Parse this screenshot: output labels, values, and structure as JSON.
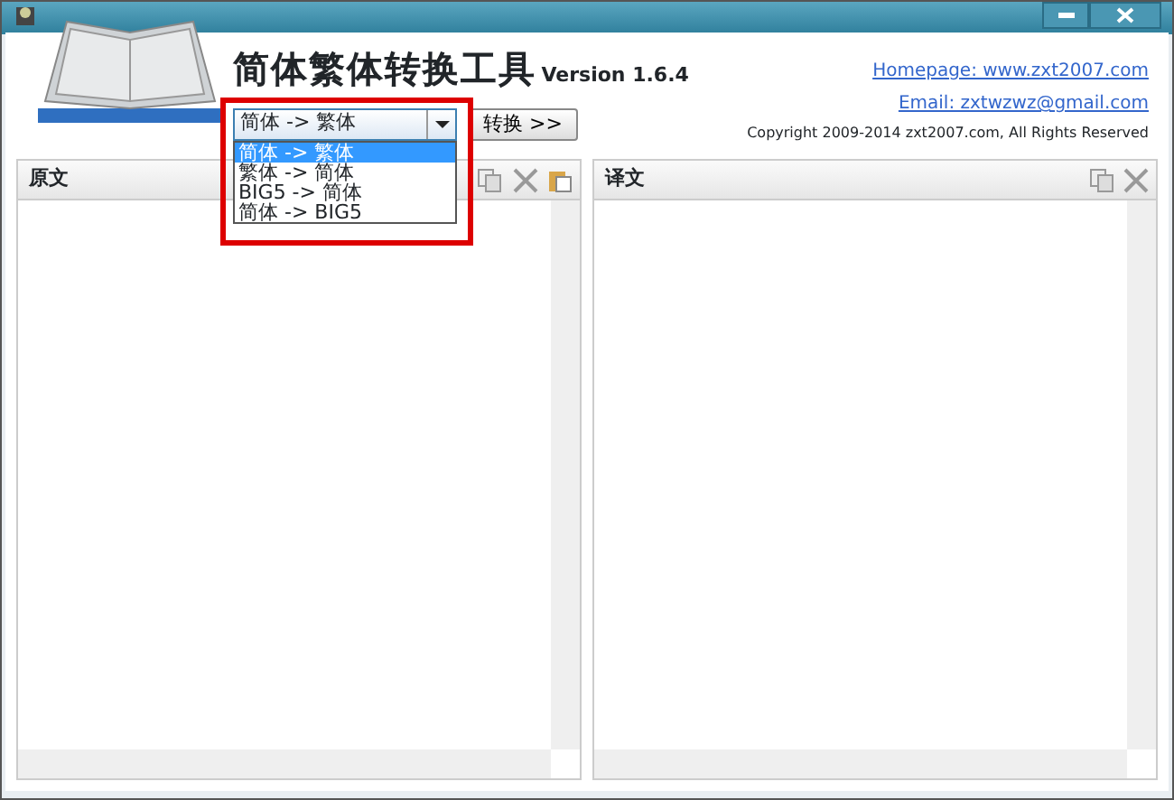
{
  "app_title": "简体繁体转换工具",
  "version": "Version 1.6.4",
  "links": [
    "Homepage: www.zxt2007.com",
    "Email: zxtwzwz@gmail.com"
  ],
  "copyright": "Copyright 2009-2014 zxt2007.com, All Rights Reserved",
  "mode_select": {
    "value": "简体 -> 繁体",
    "expanded": true,
    "options": [
      {
        "label": "简体 -> 繁体",
        "selected": true
      },
      {
        "label": "繁体 -> 简体",
        "selected": false
      },
      {
        "label": "BIG5 -> 简体",
        "selected": false
      },
      {
        "label": "简体 -> BIG5",
        "selected": false
      }
    ]
  },
  "convert_button": "转换 >>",
  "panels": [
    {
      "title": "原文",
      "paste": true
    },
    {
      "title": "译文",
      "paste": false
    }
  ]
}
